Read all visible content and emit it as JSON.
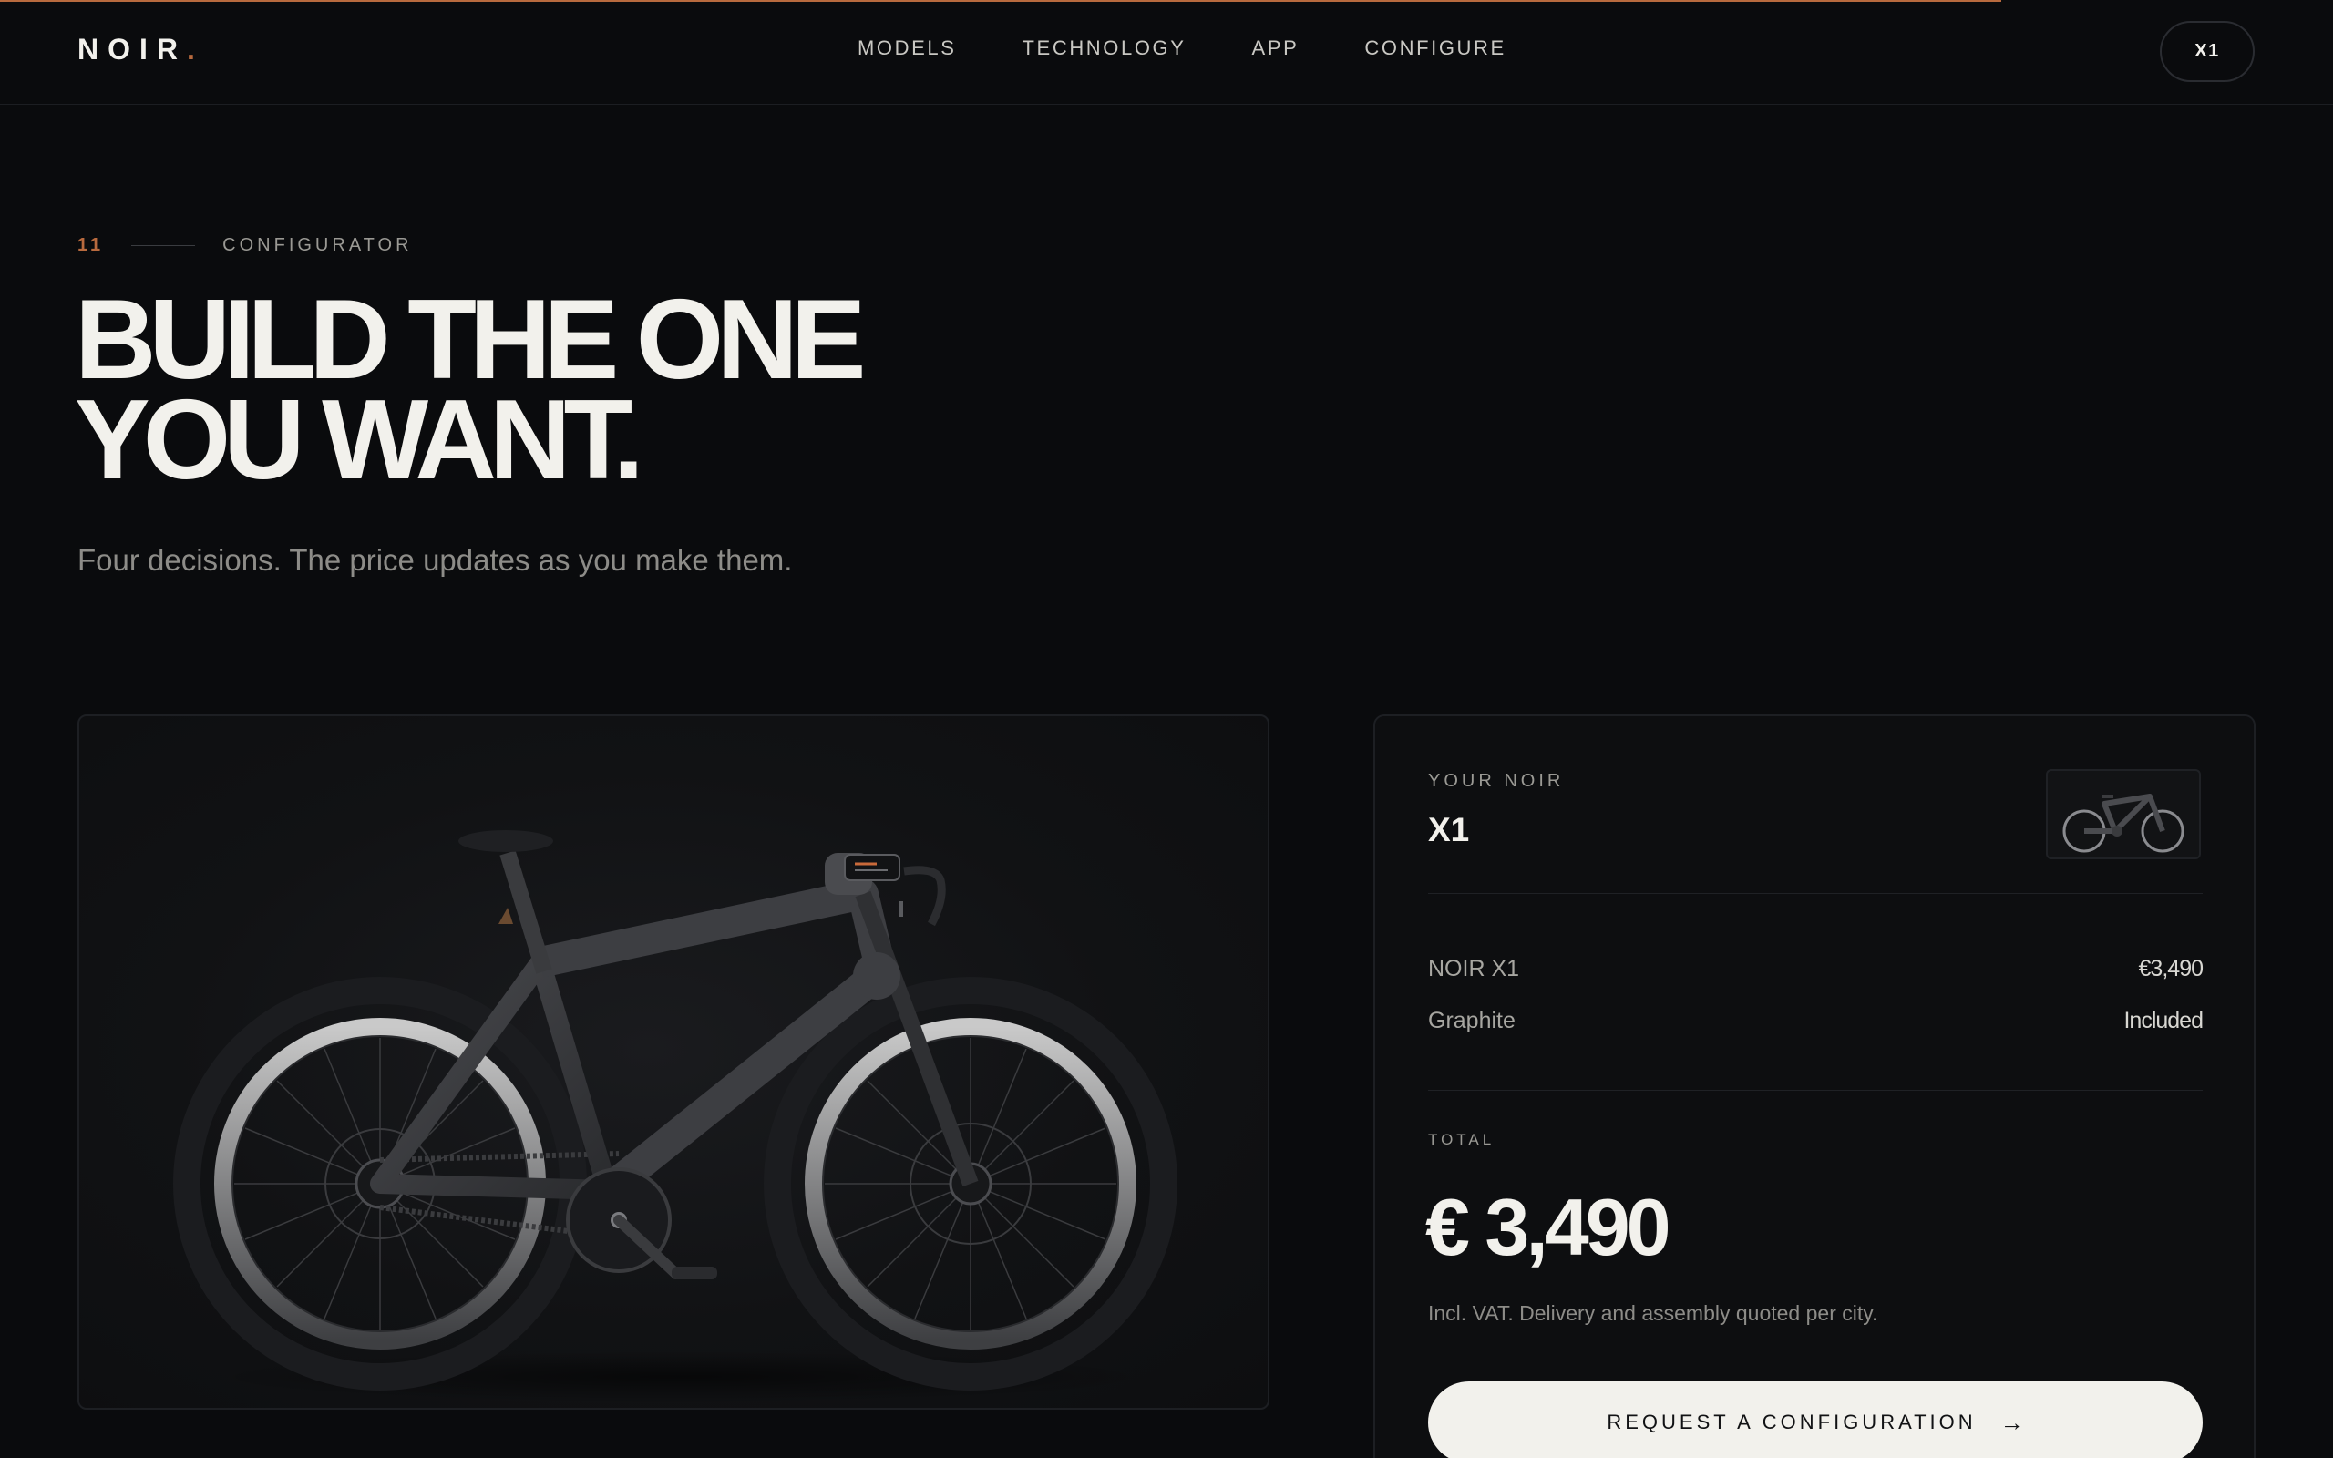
{
  "header": {
    "logo": "NOIR",
    "logo_dot": ".",
    "nav": [
      "MODELS",
      "TECHNOLOGY",
      "APP",
      "CONFIGURE"
    ],
    "model_pill": "X1"
  },
  "hero": {
    "section_number": "11",
    "section_label": "CONFIGURATOR",
    "title_line1": "BUILD THE ONE",
    "title_line2": "YOU WANT.",
    "subtitle": "Four decisions. The price updates as you make them."
  },
  "preview": {
    "icon": "bicycle-illustration"
  },
  "summary": {
    "kicker": "YOUR NOIR",
    "model_name": "X1",
    "thumbnail_icon": "bicycle-thumbnail",
    "items": [
      {
        "name": "NOIR X1",
        "price": "€3,490"
      },
      {
        "name": "Graphite",
        "price": "Included"
      }
    ],
    "total_label": "TOTAL",
    "total_value": "€ 3,490",
    "total_note": "Incl. VAT. Delivery and assembly quoted per city.",
    "cta_label": "REQUEST A CONFIGURATION",
    "cta_icon": "arrow-right-icon"
  },
  "colors": {
    "accent": "#b86a3e",
    "background": "#0a0b0d",
    "text": "#f2f1ec"
  }
}
